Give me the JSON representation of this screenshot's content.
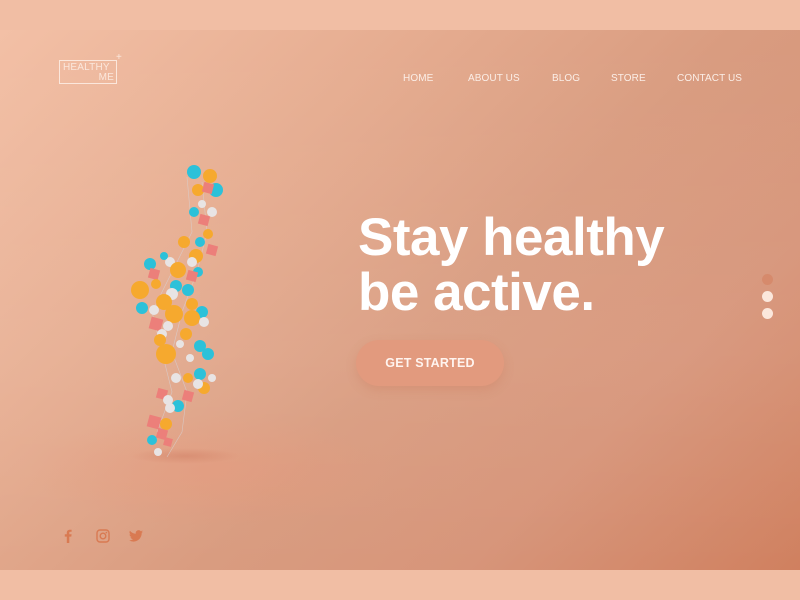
{
  "brand": {
    "logo_line1": "HEALTHY",
    "logo_line2": "ME",
    "logo_plus": "+"
  },
  "nav": {
    "items": [
      {
        "label": "HOME"
      },
      {
        "label": "ABOUT US"
      },
      {
        "label": "BLOG"
      },
      {
        "label": "STORE"
      },
      {
        "label": "CONTACT US"
      }
    ]
  },
  "hero": {
    "headline_line1": "Stay healthy",
    "headline_line2": "be active.",
    "cta_label": "GET STARTED",
    "illustration": "molecular-figure-running"
  },
  "slider": {
    "total": 3,
    "active_index": 0
  },
  "social": {
    "icons": [
      "facebook-icon",
      "instagram-icon",
      "twitter-icon"
    ]
  },
  "colors": {
    "background": "#f1bea4",
    "accent": "#d68a6c",
    "text_light": "#ffffff",
    "figure_orange": "#f6a92e",
    "figure_cyan": "#2cc1d9",
    "figure_pink": "#ec7f7a",
    "figure_white": "#e8e4e4"
  }
}
